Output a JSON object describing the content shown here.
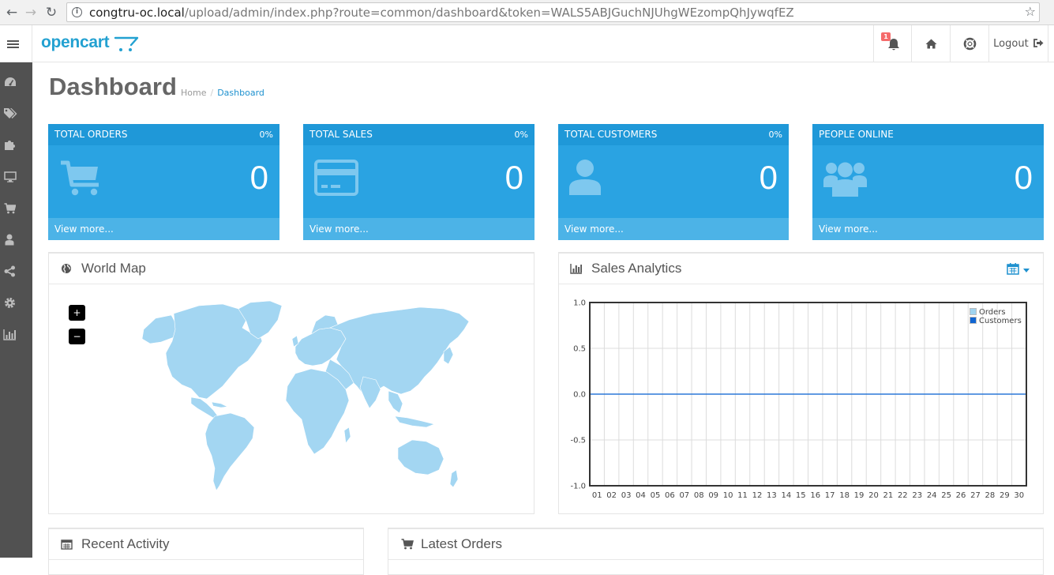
{
  "browser": {
    "url_host": "congtru-oc.local",
    "url_path": "/upload/admin/index.php?route=common/dashboard&token=WALS5ABJGuchNJUhgWEzompQhJywqfEZ"
  },
  "header": {
    "logo_text": "opencart",
    "notification_count": "1",
    "logout_label": "Logout"
  },
  "page": {
    "title": "Dashboard",
    "breadcrumb": [
      "Home",
      "Dashboard"
    ]
  },
  "tiles": [
    {
      "title": "TOTAL ORDERS",
      "percent": "0%",
      "value": "0",
      "footer": "View more...",
      "icon": "shopping-cart-icon"
    },
    {
      "title": "TOTAL SALES",
      "percent": "0%",
      "value": "0",
      "footer": "View more...",
      "icon": "credit-card-icon"
    },
    {
      "title": "TOTAL CUSTOMERS",
      "percent": "0%",
      "value": "0",
      "footer": "View more...",
      "icon": "user-icon"
    },
    {
      "title": "PEOPLE ONLINE",
      "percent": "",
      "value": "0",
      "footer": "View more...",
      "icon": "users-icon"
    }
  ],
  "panels": {
    "world_map": {
      "title": "World Map",
      "zoom_in": "+",
      "zoom_out": "−"
    },
    "sales_analytics": {
      "title": "Sales Analytics"
    },
    "recent_activity": {
      "title": "Recent Activity"
    },
    "latest_orders": {
      "title": "Latest Orders"
    }
  },
  "colors": {
    "accent": "#1e91cf",
    "tile_bg": "#2aa3e2",
    "sidebar_bg": "#515151",
    "map_land": "#a3d6f2"
  },
  "chart_data": {
    "type": "line",
    "x": [
      "01",
      "02",
      "03",
      "04",
      "05",
      "06",
      "07",
      "08",
      "09",
      "10",
      "11",
      "12",
      "13",
      "14",
      "15",
      "16",
      "17",
      "18",
      "19",
      "20",
      "21",
      "22",
      "23",
      "24",
      "25",
      "26",
      "27",
      "28",
      "29",
      "30"
    ],
    "yticks": [
      "1.0",
      "0.5",
      "0.0",
      "-0.5",
      "-1.0"
    ],
    "ylim": [
      -1,
      1
    ],
    "series": [
      {
        "name": "Orders",
        "color": "#9fd3ef",
        "values": [
          0,
          0,
          0,
          0,
          0,
          0,
          0,
          0,
          0,
          0,
          0,
          0,
          0,
          0,
          0,
          0,
          0,
          0,
          0,
          0,
          0,
          0,
          0,
          0,
          0,
          0,
          0,
          0,
          0,
          0
        ]
      },
      {
        "name": "Customers",
        "color": "#1065d2",
        "values": [
          0,
          0,
          0,
          0,
          0,
          0,
          0,
          0,
          0,
          0,
          0,
          0,
          0,
          0,
          0,
          0,
          0,
          0,
          0,
          0,
          0,
          0,
          0,
          0,
          0,
          0,
          0,
          0,
          0,
          0
        ]
      }
    ],
    "grid": true,
    "legend": "top-right"
  }
}
